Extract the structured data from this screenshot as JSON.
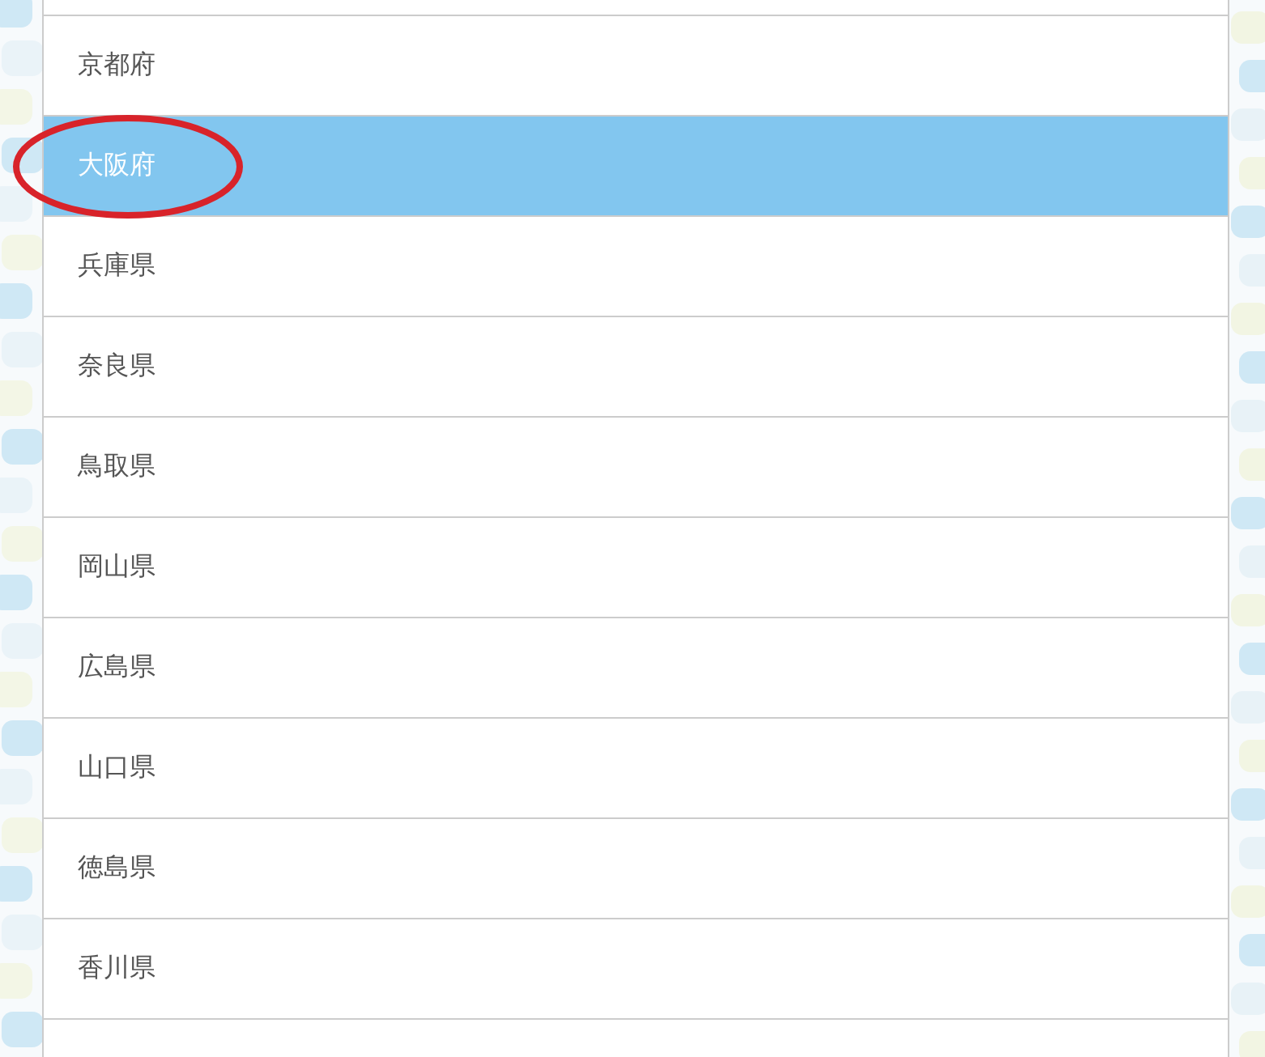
{
  "list": {
    "items": [
      {
        "label": "京都府",
        "selected": false,
        "circled": false
      },
      {
        "label": "大阪府",
        "selected": true,
        "circled": true
      },
      {
        "label": "兵庫県",
        "selected": false,
        "circled": false
      },
      {
        "label": "奈良県",
        "selected": false,
        "circled": false
      },
      {
        "label": "鳥取県",
        "selected": false,
        "circled": false
      },
      {
        "label": "岡山県",
        "selected": false,
        "circled": false
      },
      {
        "label": "広島県",
        "selected": false,
        "circled": false
      },
      {
        "label": "山口県",
        "selected": false,
        "circled": false
      },
      {
        "label": "徳島県",
        "selected": false,
        "circled": false
      },
      {
        "label": "香川県",
        "selected": false,
        "circled": false
      }
    ]
  }
}
